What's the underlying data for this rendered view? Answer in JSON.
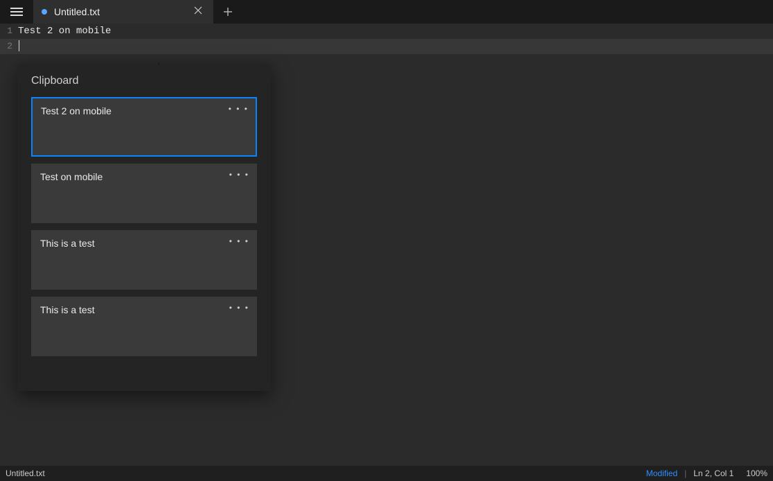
{
  "titlebar": {
    "tab_title": "Untitled.txt",
    "tab_dirty": true
  },
  "editor": {
    "lines": [
      {
        "n": "1",
        "text": "Test 2 on mobile"
      },
      {
        "n": "2",
        "text": ""
      }
    ],
    "current_line_index": 1
  },
  "clipboard": {
    "title": "Clipboard",
    "items": [
      {
        "text": "Test 2 on mobile",
        "selected": true
      },
      {
        "text": "Test on mobile",
        "selected": false
      },
      {
        "text": "This is a test",
        "selected": false
      },
      {
        "text": "This is a test",
        "selected": false
      }
    ]
  },
  "statusbar": {
    "filename": "Untitled.txt",
    "modified_label": "Modified",
    "position": "Ln 2, Col 1",
    "zoom": "100%"
  }
}
